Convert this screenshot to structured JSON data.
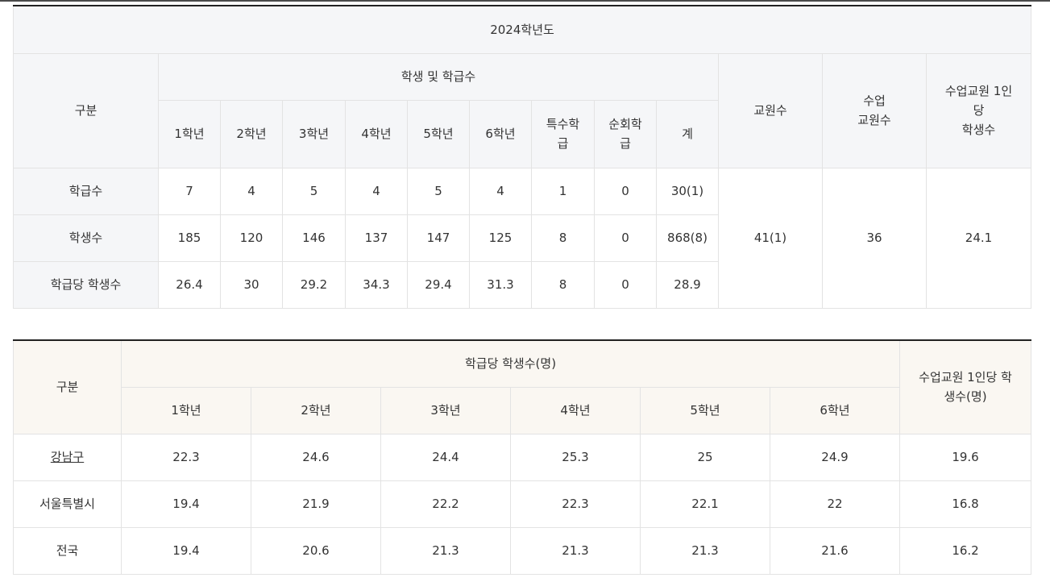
{
  "table1": {
    "year_title": "2024학년도",
    "col_category": "구분",
    "col_students_classes": "학생 및 학급수",
    "grades": [
      "1학년",
      "2학년",
      "3학년",
      "4학년",
      "5학년",
      "6학년"
    ],
    "special_class": "특수학급",
    "itinerant_class": "순회학급",
    "total": "계",
    "teachers": "교원수",
    "class_teachers": "수업교원수",
    "students_per_teacher": "수업교원 1인당학생수",
    "rows": [
      {
        "label": "학급수",
        "values": [
          "7",
          "4",
          "5",
          "4",
          "5",
          "4",
          "1",
          "0",
          "30(1)"
        ]
      },
      {
        "label": "학생수",
        "values": [
          "185",
          "120",
          "146",
          "137",
          "147",
          "125",
          "8",
          "0",
          "868(8)"
        ]
      },
      {
        "label": "학급당 학생수",
        "values": [
          "26.4",
          "30",
          "29.2",
          "34.3",
          "29.4",
          "31.3",
          "8",
          "0",
          "28.9"
        ]
      }
    ],
    "teachers_value": "41(1)",
    "class_teachers_value": "36",
    "students_per_teacher_value": "24.1"
  },
  "table2": {
    "col_category": "구분",
    "col_students_per_class": "학급당 학생수(명)",
    "grades": [
      "1학년",
      "2학년",
      "3학년",
      "4학년",
      "5학년",
      "6학년"
    ],
    "col_students_per_teacher": "수업교원 1인당 학생수(명)",
    "rows": [
      {
        "label": "강남구",
        "values": [
          "22.3",
          "24.6",
          "24.4",
          "25.3",
          "25",
          "24.9",
          "19.6"
        ]
      },
      {
        "label": "서울특별시",
        "values": [
          "19.4",
          "21.9",
          "22.2",
          "22.3",
          "22.1",
          "22",
          "16.8"
        ]
      },
      {
        "label": "전국",
        "values": [
          "19.4",
          "20.6",
          "21.3",
          "21.3",
          "21.3",
          "21.6",
          "16.2"
        ]
      }
    ]
  }
}
